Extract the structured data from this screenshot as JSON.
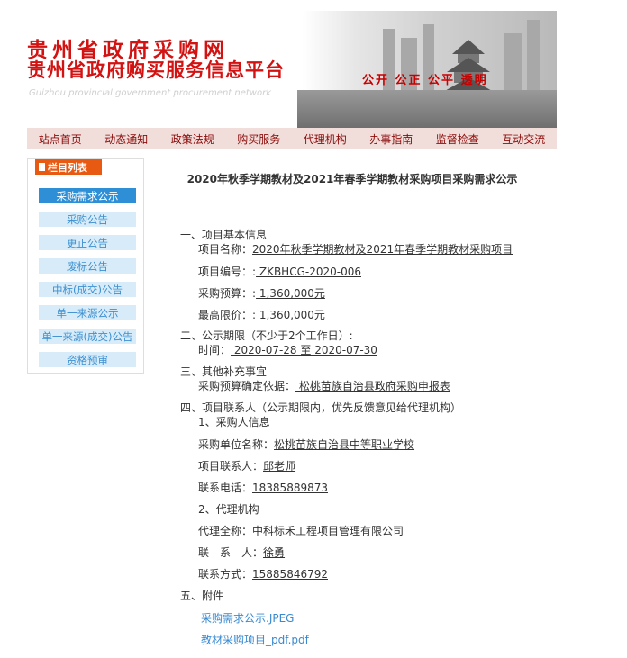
{
  "header": {
    "title_line1": "贵州省政府采购网",
    "title_line2": "贵州省政府购买服务信息平台",
    "title_en": "Guizhou provincial government procurement network",
    "motto": "公开 公正 公平 透明"
  },
  "nav": [
    "站点首页",
    "动态通知",
    "政策法规",
    "购买服务",
    "代理机构",
    "办事指南",
    "监督检查",
    "互动交流"
  ],
  "sidebar": {
    "heading": "栏目列表",
    "items": [
      "采购需求公示",
      "采购公告",
      "更正公告",
      "废标公告",
      "中标(成交)公告",
      "单一来源公示",
      "单一来源(成交)公告",
      "资格预审"
    ]
  },
  "article": {
    "title": "2020年秋季学期教材及2021年春季学期教材采购项目采购需求公示",
    "s1": "一、项目基本信息",
    "name_label": "项目名称：",
    "name_value": "2020年秋季学期教材及2021年春季学期教材采购项目",
    "code_label": "项目编号：:",
    "code_value": " ZKBHCG-2020-006",
    "budget_label": "采购预算：:",
    "budget_value": " 1,360,000元",
    "max_label": "最高限价：:",
    "max_value": " 1,360,000元",
    "s2": "二、公示期限（不少于2个工作日）:",
    "time_label": "时间：",
    "time_value": " 2020-07-28 至 2020-07-30",
    "s3": "三、其他补充事宜",
    "basis_label": "采购预算确定依据：",
    "basis_value": " 松桃苗族自治县政府采购申报表",
    "s4": "四、项目联系人（公示期限内，优先反馈意见给代理机构）",
    "sub1": "1、采购人信息",
    "buyer_label": "采购单位名称：",
    "buyer_value": "松桃苗族自治县中等职业学校",
    "contact_label": "项目联系人：",
    "contact_value": "邱老师",
    "phone_label": "联系电话：",
    "phone_value": "18385889873",
    "sub2": "2、代理机构",
    "agent_label": "代理全称：",
    "agent_value": "中科标禾工程项目管理有限公司",
    "agent_contact_label": "联　系　人：",
    "agent_contact_value": "徐勇",
    "agent_phone_label": "联系方式：",
    "agent_phone_value": "15885846792",
    "s5": "五、附件",
    "attachments": [
      "采购需求公示.JPEG",
      "教材采购项目_pdf.pdf"
    ]
  },
  "colors": {
    "accent_red": "#d31212",
    "nav_bg": "#f1ddd9",
    "link_blue": "#3a8ad0",
    "side_active": "#2f8fd6",
    "side_head": "#e85a12"
  }
}
